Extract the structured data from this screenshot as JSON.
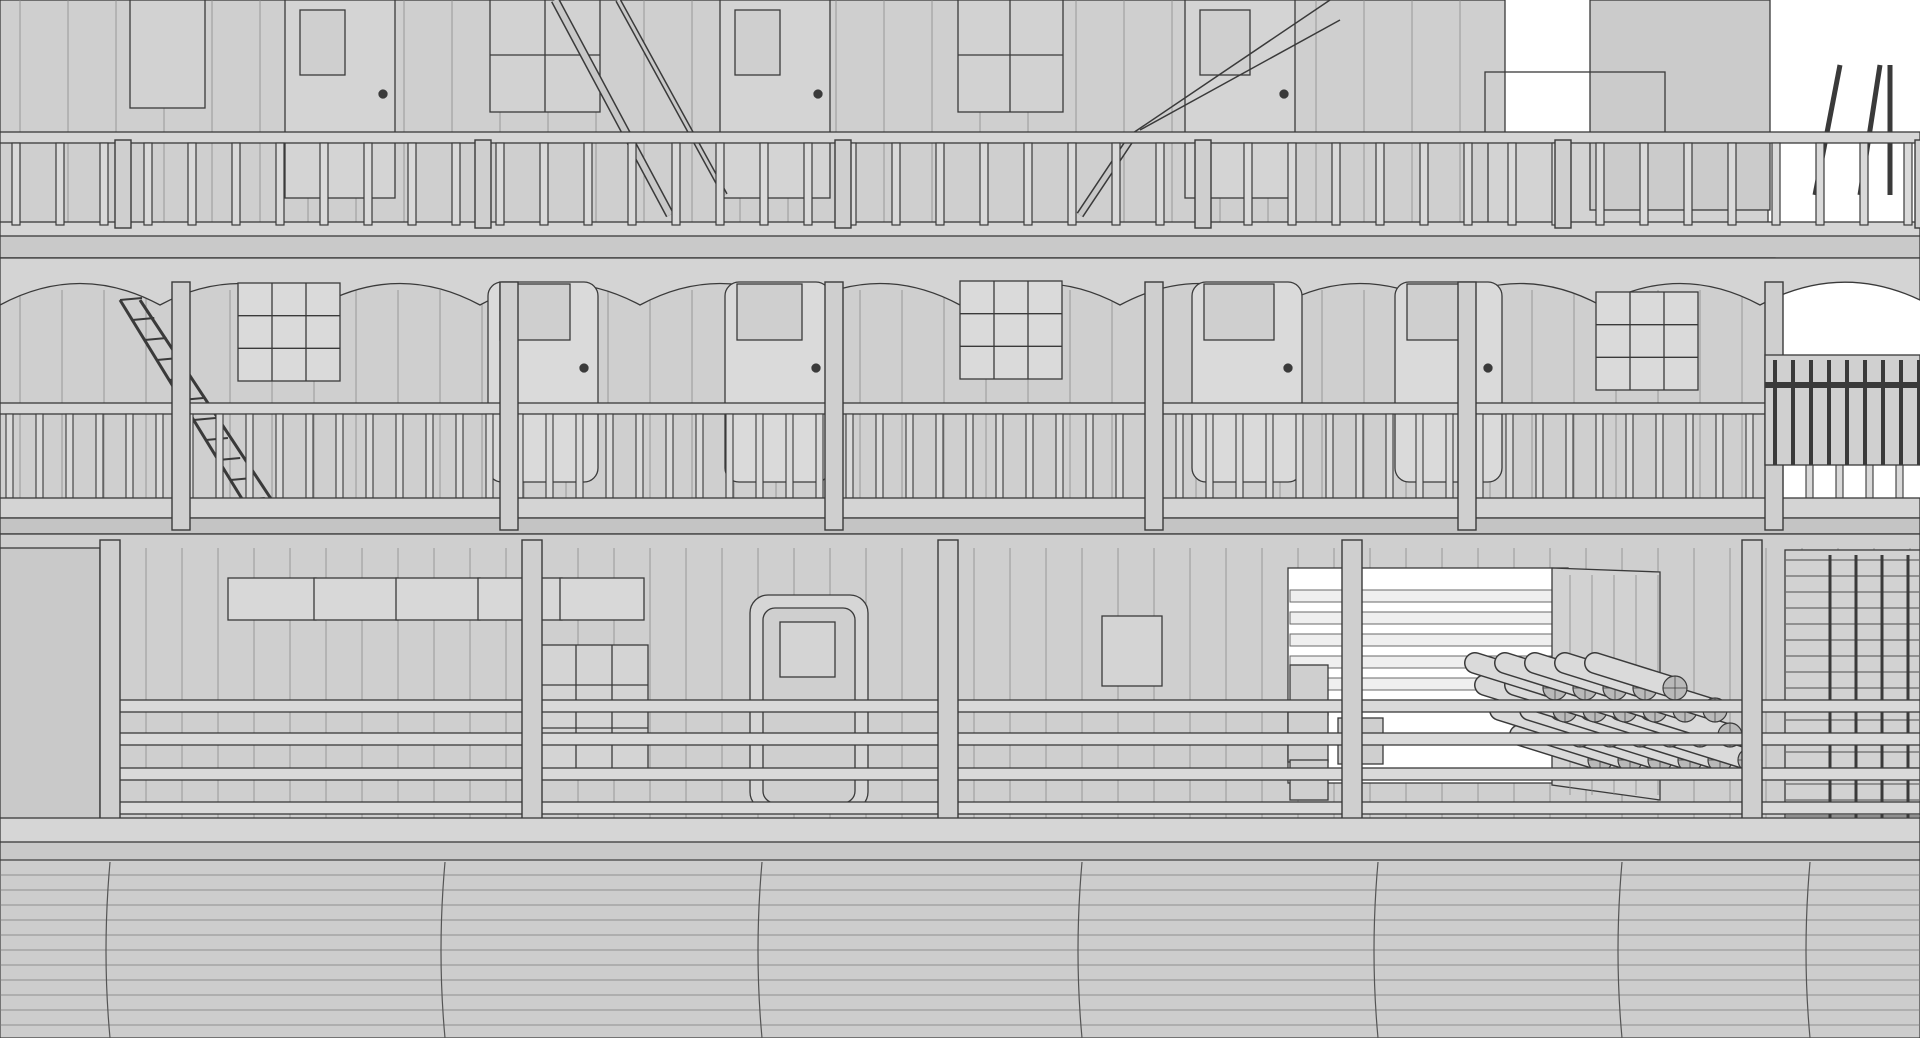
{
  "scene": {
    "kind": "wireframe-3d-render",
    "subject": "riverboat",
    "palette": {
      "background": "#ffffff",
      "surface": "#cfcfcf",
      "surface_light": "#dadada",
      "surface_dark": "#b9b9b9",
      "line": "#3a3a3a",
      "line_light": "#8a8a8a"
    },
    "decks": [
      {
        "name": "upper-deck",
        "railing": true,
        "doors": 4,
        "windows": 3
      },
      {
        "name": "middle-deck",
        "railing": true,
        "doors": 4,
        "windows": 3,
        "awning": "scalloped"
      },
      {
        "name": "main-deck",
        "railing": true,
        "doors": 1,
        "windows": 2,
        "cargo": [
          "log-pile",
          "barrels"
        ]
      }
    ],
    "hull": {
      "planking": true
    }
  }
}
